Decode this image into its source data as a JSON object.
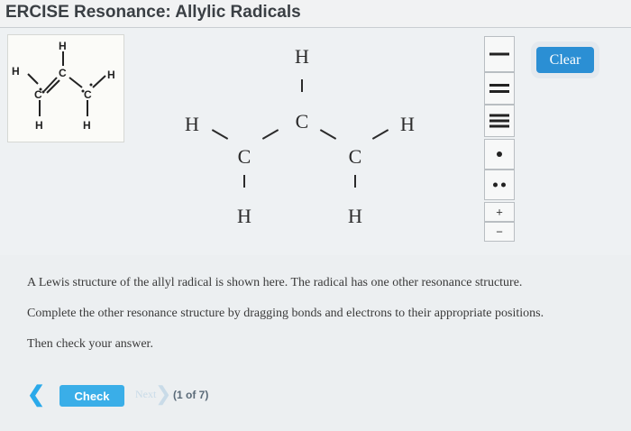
{
  "header": {
    "title": "ERCISE  Resonance: Allylic Radicals"
  },
  "thumbnail": {
    "atoms": [
      "H",
      "C",
      "H",
      "C",
      "C",
      "H",
      "H",
      "H"
    ]
  },
  "canvas": {
    "atoms": {
      "h_top": "H",
      "c_center": "C",
      "h_left": "H",
      "h_right": "H",
      "c_left": "C",
      "c_right": "C",
      "h_bottom_left": "H",
      "h_bottom_right": "H"
    }
  },
  "toolbar": {
    "tools": [
      {
        "name": "single-bond-tool",
        "symbol": "|"
      },
      {
        "name": "double-bond-tool",
        "symbol": "||"
      },
      {
        "name": "triple-bond-tool",
        "symbol": "|||"
      },
      {
        "name": "single-electron-tool",
        "symbol": "•"
      },
      {
        "name": "electron-pair-tool",
        "symbol": "••"
      },
      {
        "name": "positive-charge-tool",
        "symbol": "+"
      },
      {
        "name": "negative-charge-tool",
        "symbol": "−"
      }
    ]
  },
  "clear_label": "Clear",
  "instructions": {
    "line1": "A Lewis structure of the allyl radical is shown here. The radical has one other resonance structure.",
    "line2": "Complete the other resonance structure by dragging bonds and electrons to their appropriate positions.",
    "line3": "Then check your answer."
  },
  "footer": {
    "back_symbol": "❮",
    "check_label": "Check",
    "next_label": "Next",
    "next_symbol": "❯",
    "progress": "(1 of 7)"
  },
  "colors": {
    "accent": "#2b8fd4",
    "check": "#3aaee8",
    "text": "#3a3a3a"
  }
}
